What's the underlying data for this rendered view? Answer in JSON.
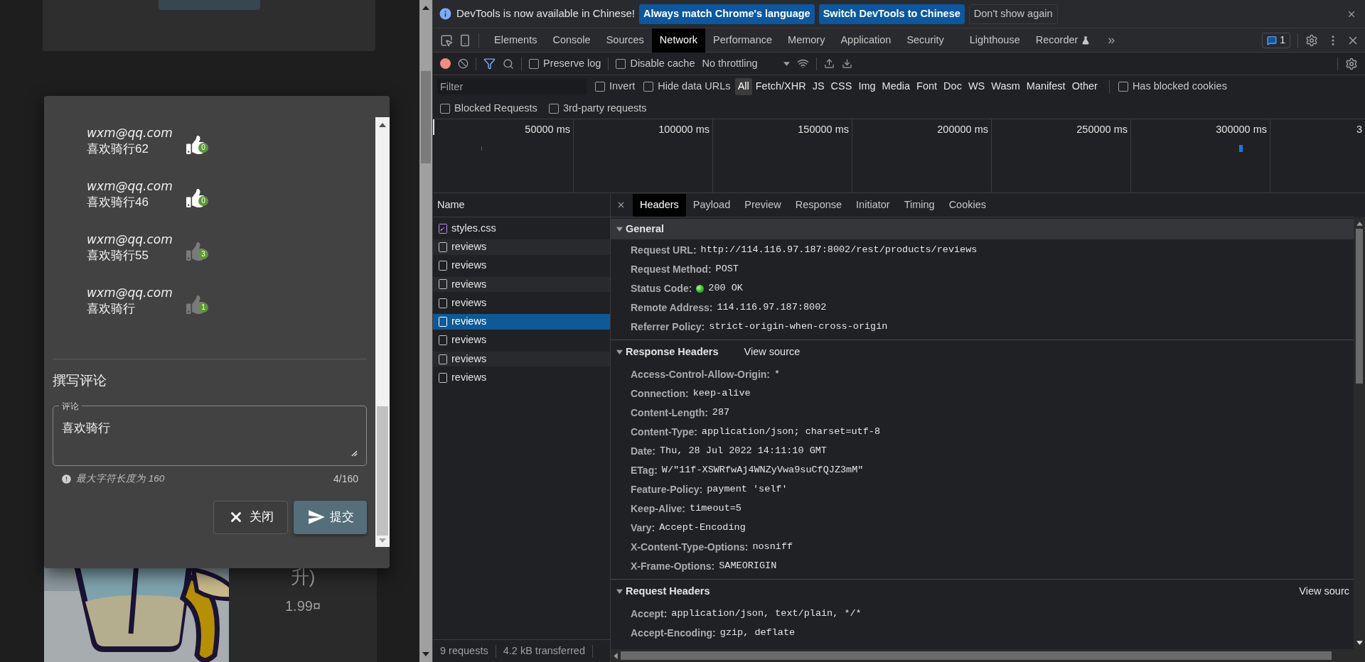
{
  "page": {
    "review_dialog": {
      "reviews": [
        {
          "author": "wxm@qq.com",
          "text": "喜欢骑行62",
          "likes": "0",
          "liked": true
        },
        {
          "author": "wxm@qq.com",
          "text": "喜欢骑行46",
          "likes": "0",
          "liked": true
        },
        {
          "author": "wxm@qq.com",
          "text": "喜欢骑行55",
          "likes": "3",
          "liked": false
        },
        {
          "author": "wxm@qq.com",
          "text": "喜欢骑行",
          "likes": "1",
          "liked": false
        }
      ],
      "compose_title": "撰写评论",
      "comment_field": {
        "label": "评论",
        "value": "喜欢骑行"
      },
      "hint": "最大字符长度为 160",
      "counter": "4/160",
      "buttons": [
        {
          "label": "关闭",
          "kind": "close"
        },
        {
          "label": "提交",
          "kind": "submit"
        }
      ]
    },
    "product_card": {
      "title": "升)",
      "price": "1.99¤"
    }
  },
  "devtools": {
    "infobar": {
      "message": "DevTools is now available in Chinese!",
      "buttons": [
        {
          "label": "Always match Chrome's language",
          "kind": "primary"
        },
        {
          "label": "Switch DevTools to Chinese",
          "kind": "primary"
        },
        {
          "label": "Don't show again",
          "kind": "plain"
        }
      ]
    },
    "panel_tabs": [
      {
        "label": "Elements",
        "selected": false
      },
      {
        "label": "Console",
        "selected": false
      },
      {
        "label": "Sources",
        "selected": false
      },
      {
        "label": "Network",
        "selected": true
      },
      {
        "label": "Performance",
        "selected": false
      },
      {
        "label": "Memory",
        "selected": false
      },
      {
        "label": "Application",
        "selected": false
      },
      {
        "label": "Security",
        "selected": false
      },
      {
        "label": "Lighthouse",
        "selected": false
      },
      {
        "label": "Recorder",
        "selected": false,
        "experimental": true
      }
    ],
    "overflow": "»",
    "issues_count": "1",
    "toolbar": {
      "preserve_log": {
        "label": "Preserve log",
        "checked": false
      },
      "disable_cache": {
        "label": "Disable cache",
        "checked": false
      },
      "throttling": "No throttling"
    },
    "filter": {
      "placeholder": "Filter",
      "invert": {
        "label": "Invert",
        "checked": false
      },
      "hide_data_urls": {
        "label": "Hide data URLs",
        "checked": false
      },
      "types": [
        {
          "label": "All",
          "selected": true
        },
        {
          "label": "Fetch/XHR",
          "selected": false
        },
        {
          "label": "JS",
          "selected": false
        },
        {
          "label": "CSS",
          "selected": false
        },
        {
          "label": "Img",
          "selected": false
        },
        {
          "label": "Media",
          "selected": false
        },
        {
          "label": "Font",
          "selected": false
        },
        {
          "label": "Doc",
          "selected": false
        },
        {
          "label": "WS",
          "selected": false
        },
        {
          "label": "Wasm",
          "selected": false
        },
        {
          "label": "Manifest",
          "selected": false
        },
        {
          "label": "Other",
          "selected": false
        }
      ],
      "has_blocked_cookies": {
        "label": "Has blocked cookies",
        "checked": false
      },
      "blocked_requests": {
        "label": "Blocked Requests",
        "checked": false
      },
      "third_party_requests": {
        "label": "3rd-party requests",
        "checked": false
      }
    },
    "timeline": {
      "ticks": [
        "50000 ms",
        "100000 ms",
        "150000 ms",
        "200000 ms",
        "250000 ms",
        "300000 ms",
        "3"
      ]
    },
    "requests": {
      "header": "Name",
      "rows": [
        {
          "name": "styles.css",
          "kind": "stylesheet",
          "selected": false
        },
        {
          "name": "reviews",
          "kind": "fetch",
          "selected": false
        },
        {
          "name": "reviews",
          "kind": "fetch",
          "selected": false
        },
        {
          "name": "reviews",
          "kind": "fetch",
          "selected": false
        },
        {
          "name": "reviews",
          "kind": "fetch",
          "selected": false
        },
        {
          "name": "reviews",
          "kind": "fetch",
          "selected": true
        },
        {
          "name": "reviews",
          "kind": "fetch",
          "selected": false
        },
        {
          "name": "reviews",
          "kind": "fetch",
          "selected": false
        },
        {
          "name": "reviews",
          "kind": "fetch",
          "selected": false
        }
      ]
    },
    "detail_tabs": [
      {
        "label": "Headers",
        "selected": true
      },
      {
        "label": "Payload",
        "selected": false
      },
      {
        "label": "Preview",
        "selected": false
      },
      {
        "label": "Response",
        "selected": false
      },
      {
        "label": "Initiator",
        "selected": false
      },
      {
        "label": "Timing",
        "selected": false
      },
      {
        "label": "Cookies",
        "selected": false
      }
    ],
    "sections": [
      {
        "title": "General",
        "kind": "general",
        "expanded": true,
        "highlighted": true,
        "headers": [
          {
            "name": "Request URL:",
            "value": "http://114.116.97.187:8002/rest/products/reviews"
          },
          {
            "name": "Request Method:",
            "value": "POST"
          },
          {
            "name": "Status Code:",
            "value": "200 OK",
            "status_ok": true
          },
          {
            "name": "Remote Address:",
            "value": "114.116.97.187:8002"
          },
          {
            "name": "Referrer Policy:",
            "value": "strict-origin-when-cross-origin"
          }
        ]
      },
      {
        "title": "Response Headers",
        "kind": "response",
        "expanded": true,
        "highlighted": false,
        "view_source": "View source",
        "headers": [
          {
            "name": "Access-Control-Allow-Origin:",
            "value": "*"
          },
          {
            "name": "Connection:",
            "value": "keep-alive"
          },
          {
            "name": "Content-Length:",
            "value": "287"
          },
          {
            "name": "Content-Type:",
            "value": "application/json; charset=utf-8"
          },
          {
            "name": "Date:",
            "value": "Thu, 28 Jul 2022 14:11:10 GMT"
          },
          {
            "name": "ETag:",
            "value": "W/\"11f-XSWRfwAj4WNZyVwa9suCfQJZ3mM\""
          },
          {
            "name": "Feature-Policy:",
            "value": "payment 'self'"
          },
          {
            "name": "Keep-Alive:",
            "value": "timeout=5"
          },
          {
            "name": "Vary:",
            "value": "Accept-Encoding"
          },
          {
            "name": "X-Content-Type-Options:",
            "value": "nosniff"
          },
          {
            "name": "X-Frame-Options:",
            "value": "SAMEORIGIN"
          }
        ]
      },
      {
        "title": "Request Headers",
        "kind": "request",
        "expanded": true,
        "highlighted": false,
        "view_source": "View sourc",
        "headers": [
          {
            "name": "Accept:",
            "value": "application/json, text/plain, */*"
          },
          {
            "name": "Accept-Encoding:",
            "value": "gzip, deflate"
          }
        ]
      }
    ],
    "status_bar": {
      "requests": "9 requests",
      "transferred": "4.2 kB transferred"
    }
  }
}
